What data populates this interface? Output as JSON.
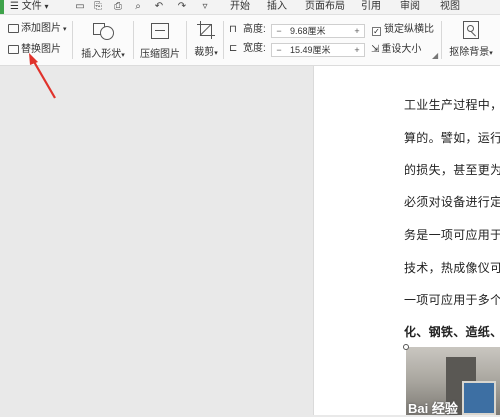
{
  "menubar": {
    "file_label": "文件",
    "tabs": [
      "开始",
      "插入",
      "页面布局",
      "引用",
      "审阅",
      "视图"
    ]
  },
  "ribbon": {
    "add_picture": "添加图片",
    "replace_picture": "替换图片",
    "insert_shape": "插入形状",
    "compress_picture": "压缩图片",
    "crop": "裁剪",
    "height_label": "高度:",
    "height_value": "9.68厘米",
    "width_label": "宽度:",
    "width_value": "15.49厘米",
    "lock_ratio": "锁定纵横比",
    "reset_size": "重设大小",
    "remove_background": "抠除背景"
  },
  "document": {
    "lines": [
      "工业生产过程中，",
      "算的。譬如，运行",
      "的损失，甚至更为",
      "必须对设备进行定",
      "务是一项可应用于",
      "技术，热成像仪可",
      "一项可应用于多个"
    ],
    "bold_line": "化、钢铁、造纸、"
  },
  "watermark": "Bai 经验",
  "colors": {
    "accent_green": "#3ea34a",
    "arrow_red": "#e0322b",
    "ribbon_bg": "#fbfbfb"
  }
}
